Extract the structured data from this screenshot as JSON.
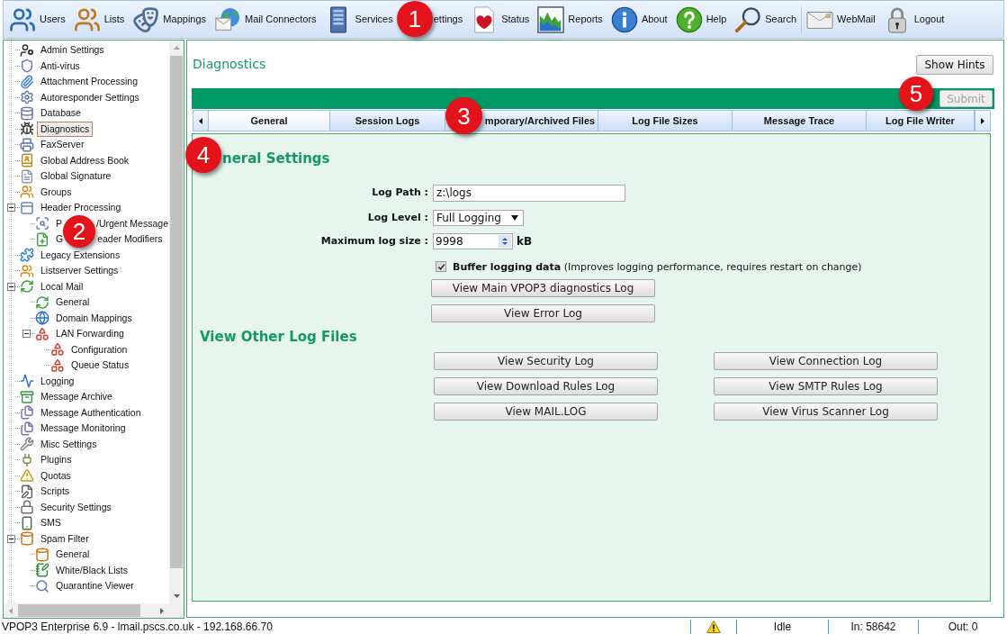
{
  "toolbar": {
    "groups": [
      {
        "items": [
          "Users",
          "Lists",
          "Mappings",
          "Mail Connectors",
          "Services",
          "ettings",
          "Status",
          "Reports",
          "About",
          "Help",
          "Search"
        ]
      },
      {
        "items": [
          "WebMail",
          "Logout"
        ]
      }
    ]
  },
  "sidebar": {
    "tree": [
      {
        "label": "Admin Settings",
        "selected": false
      },
      {
        "label": "Anti-virus",
        "selected": false
      },
      {
        "label": "Attachment Processing",
        "selected": false
      },
      {
        "label": "Autoresponder Settings",
        "selected": false
      },
      {
        "label": "Database",
        "selected": false
      },
      {
        "label": "Diagnostics",
        "selected": true
      },
      {
        "label": "FaxServer",
        "selected": false
      },
      {
        "label": "Global Address Book",
        "selected": false
      },
      {
        "label": "Global Signature",
        "selected": false
      },
      {
        "label": "Groups",
        "selected": false
      },
      {
        "label": "Header Processing",
        "selected": false,
        "expanded": true,
        "children": [
          {
            "label_parts": [
              "P",
              "/Urgent Message"
            ],
            "selected": false
          },
          {
            "label_parts": [
              "G",
              "eader Modifiers"
            ],
            "selected": false
          }
        ]
      },
      {
        "label": "Legacy Extensions",
        "selected": false
      },
      {
        "label": "Listserver Settings",
        "selected": false
      },
      {
        "label": "Local Mail",
        "selected": false,
        "expanded": true,
        "children": [
          {
            "label": "General",
            "selected": false
          },
          {
            "label": "Domain Mappings",
            "selected": false
          },
          {
            "label": "LAN Forwarding",
            "selected": false,
            "expanded": true,
            "children": [
              {
                "label": "Configuration",
                "selected": false
              },
              {
                "label": "Queue Status",
                "selected": false
              }
            ]
          }
        ]
      },
      {
        "label": "Logging",
        "selected": false
      },
      {
        "label": "Message Archive",
        "selected": false
      },
      {
        "label": "Message Authentication",
        "selected": false
      },
      {
        "label": "Message Monitoring",
        "selected": false
      },
      {
        "label": "Misc Settings",
        "selected": false
      },
      {
        "label": "Plugins",
        "selected": false
      },
      {
        "label": "Quotas",
        "selected": false
      },
      {
        "label": "Scripts",
        "selected": false
      },
      {
        "label": "Security Settings",
        "selected": false
      },
      {
        "label": "SMS",
        "selected": false
      },
      {
        "label": "Spam Filter",
        "selected": false,
        "expanded": true,
        "children": [
          {
            "label": "General",
            "selected": false
          },
          {
            "label": "White/Black Lists",
            "selected": false
          },
          {
            "label": "Quarantine Viewer",
            "selected": false
          }
        ]
      }
    ]
  },
  "main": {
    "title": "Diagnostics",
    "hints_button": "Show Hints",
    "submit_button": {
      "label": "Submit",
      "disabled": true
    },
    "tabs": [
      {
        "label": "General",
        "selected": true
      },
      {
        "label": "Session Logs",
        "selected": false
      },
      {
        "label": "mporary/Archived Files",
        "selected": false
      },
      {
        "label": "Log File Sizes",
        "selected": false
      },
      {
        "label": "Message Trace",
        "selected": false
      },
      {
        "label": "Log File Writer",
        "selected": false
      }
    ],
    "panel": {
      "heading": "neral Settings",
      "fields": [
        {
          "kind": "text",
          "label": "Log Path :",
          "value": "z:\\logs"
        },
        {
          "kind": "select",
          "label": "Log Level :",
          "value": "Full Logging"
        },
        {
          "kind": "number",
          "label": "Maximum log size :",
          "value": "9998",
          "unit": "kB"
        }
      ],
      "buffer_option": {
        "text": "**Buffer logging data** (Improves logging performance, requires restart on change)",
        "checked": true
      },
      "buttons": [
        "View Main VPOP3 diagnostics Log",
        "View Error Log"
      ],
      "other_logs": {
        "heading": "View Other Log Files",
        "buttons": [
          "View Security Log",
          "View Connection Log",
          "View Download Rules Log",
          "View SMTP Rules Log",
          "View MAIL.LOG",
          "View Virus Scanner Log"
        ]
      }
    }
  },
  "status_bar": {
    "connection": "VPOP3 Enterprise 6.9 - lmail.pscs.co.uk - 192.168.66.70",
    "state": "Idle",
    "incoming": "In: 58642",
    "outgoing": "Out: 0"
  },
  "callouts": [
    "1",
    "2",
    "3",
    "4",
    "5"
  ]
}
